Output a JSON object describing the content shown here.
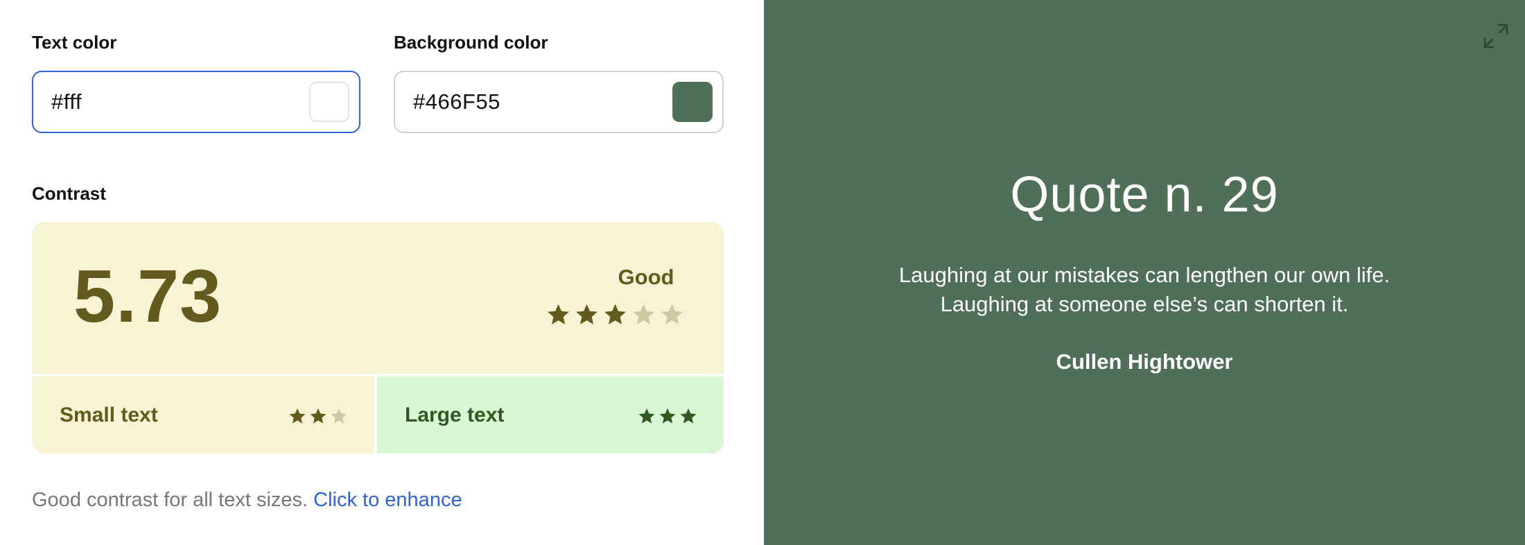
{
  "text_color": {
    "label": "Text color",
    "value": "#fff",
    "swatch": "#ffffff"
  },
  "background_color": {
    "label": "Background color",
    "value": "#466F55",
    "swatch": "#4f6f58"
  },
  "contrast": {
    "label": "Contrast",
    "ratio": "5.73",
    "rating": "Good",
    "stars_filled": 3,
    "stars_total": 5,
    "small_text": {
      "label": "Small text",
      "stars_filled": 2,
      "stars_total": 3
    },
    "large_text": {
      "label": "Large text",
      "stars_filled": 3,
      "stars_total": 3
    }
  },
  "footer": {
    "message": "Good contrast for all text sizes. ",
    "link": "Click to enhance"
  },
  "preview": {
    "title": "Quote n. 29",
    "quote_line_1": "Laughing at our mistakes can lengthen our own life.",
    "quote_line_2": "Laughing at someone else’s can shorten it.",
    "author": "Cullen Hightower",
    "expand_icon": "expand-icon"
  },
  "colors": {
    "accent_blue": "#2d63d6",
    "good_olive": "#635a1e",
    "good_bg": "#f8f3d5",
    "large_green": "#2e5a22",
    "large_bg": "#d9f7d4",
    "preview_bg": "#4f6f58"
  }
}
